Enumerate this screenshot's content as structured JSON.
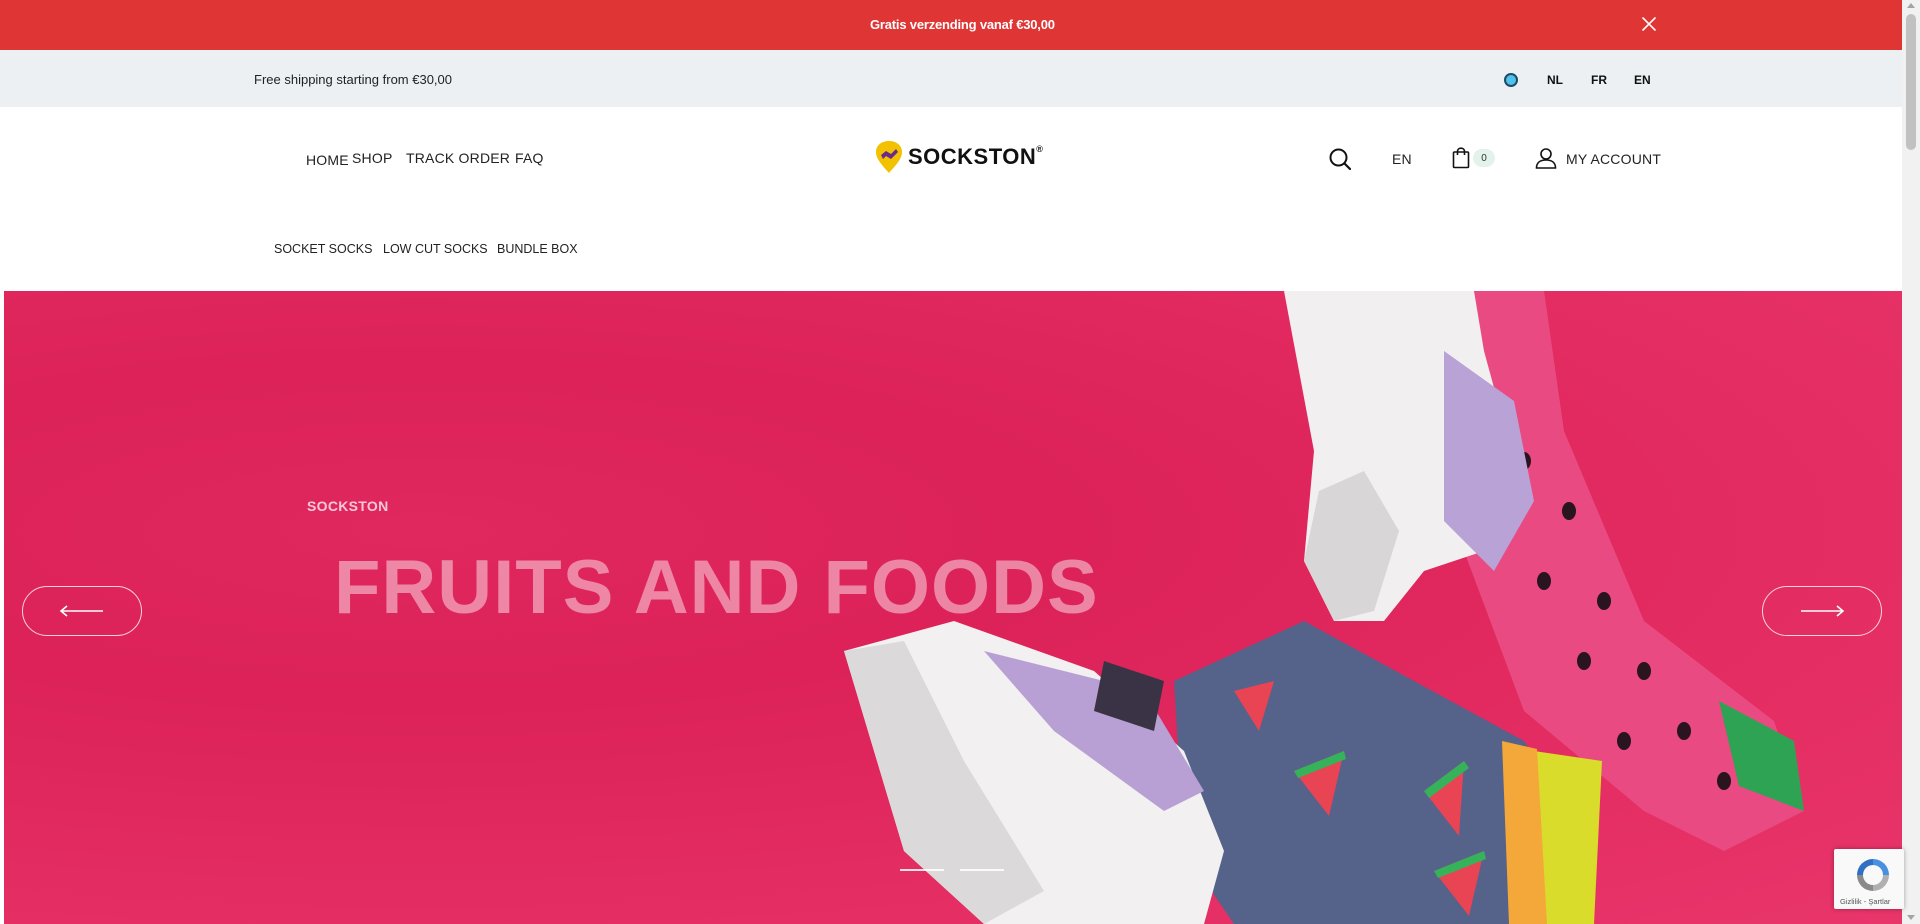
{
  "announcement": {
    "text": "Gratis verzending vanaf €30,00"
  },
  "topbar": {
    "shipping_text": "Free shipping starting from €30,00",
    "languages": [
      "NL",
      "FR",
      "EN"
    ]
  },
  "header": {
    "nav": [
      "HOME",
      "SHOP",
      "TRACK ORDER",
      "FAQ"
    ],
    "logo_text": "SOCKSTON",
    "logo_mark": "®",
    "language": "EN",
    "cart_count": "0",
    "account_label": "MY ACCOUNT",
    "subnav": [
      "SOCKET SOCKS",
      "LOW CUT SOCKS",
      "BUNDLE BOX"
    ]
  },
  "hero": {
    "kicker": "SOCKSTON",
    "title": "FRUITS AND FOODS",
    "slides": 2
  },
  "recaptcha": {
    "links": "Gizlilik - Şartlar"
  },
  "colors": {
    "announcement_bg": "#e03535",
    "topbar_bg": "#edf0f3",
    "hero_bg": "#e02a60",
    "logo_yellow": "#f2c200"
  },
  "icons": [
    "close-icon",
    "globe-icon",
    "search-icon",
    "bag-icon",
    "user-icon",
    "arrow-left-icon",
    "arrow-right-icon",
    "recaptcha-icon"
  ]
}
